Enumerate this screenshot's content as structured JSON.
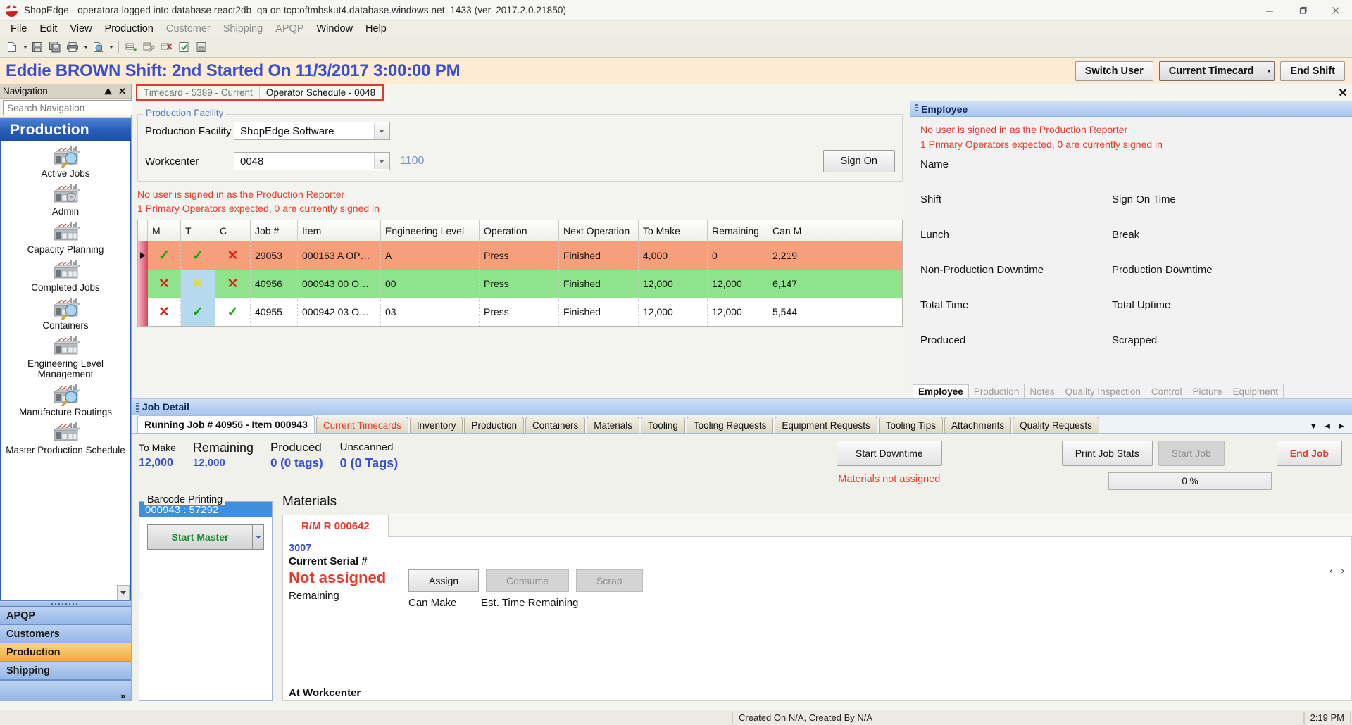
{
  "window": {
    "title": "ShopEdge - operatora logged into database react2db_qa on tcp:oftmbskut4.database.windows.net, 1433 (ver. 2017.2.0.21850)",
    "minimize": "minimize-icon",
    "maximize": "maximize-icon",
    "close": "close-icon"
  },
  "menu": [
    {
      "label": "File",
      "dim": false
    },
    {
      "label": "Edit",
      "dim": false
    },
    {
      "label": "View",
      "dim": false
    },
    {
      "label": "Production",
      "dim": false
    },
    {
      "label": "Customer",
      "dim": true
    },
    {
      "label": "Shipping",
      "dim": true
    },
    {
      "label": "APQP",
      "dim": true
    },
    {
      "label": "Window",
      "dim": false
    },
    {
      "label": "Help",
      "dim": false
    }
  ],
  "toolbar": {
    "items": [
      "new-document-icon",
      "save-icon",
      "save-all-icon",
      "print-icon",
      "print-preview-icon",
      "add-record-icon",
      "edit-record-icon",
      "delete-record-icon",
      "commit-icon",
      "export-icon"
    ]
  },
  "userbar": {
    "heading": "Eddie BROWN Shift: 2nd Started On 11/3/2017 3:00:00 PM",
    "switch_user": "Switch User",
    "current_timecard": "Current Timecard",
    "end_shift": "End Shift"
  },
  "navigation": {
    "title": "Navigation",
    "search_placeholder": "Search Navigation",
    "search_value": "",
    "clear_label": "X",
    "group_title": "Production",
    "items": [
      {
        "label": "Active Jobs",
        "icon": "factory-search-icon"
      },
      {
        "label": "Admin",
        "icon": "factory-gear-icon"
      },
      {
        "label": "Capacity Planning",
        "icon": "factory-icon"
      },
      {
        "label": "Completed Jobs",
        "icon": "factory-icon"
      },
      {
        "label": "Containers",
        "icon": "factory-search-icon"
      },
      {
        "label": "Engineering Level Management",
        "icon": "factory-icon"
      },
      {
        "label": "Manufacture Routings",
        "icon": "factory-search-icon"
      },
      {
        "label": "Master Production Schedule",
        "icon": "factory-icon"
      }
    ],
    "bars": [
      {
        "label": "APQP",
        "active": false
      },
      {
        "label": "Customers",
        "active": false
      },
      {
        "label": "Production",
        "active": true
      },
      {
        "label": "Shipping",
        "active": false
      }
    ],
    "overflow": "»"
  },
  "document_tabs": {
    "tabs": [
      {
        "label": "Timecard - 5389 - Current",
        "selected": false
      },
      {
        "label": "Operator Schedule - 0048",
        "selected": true
      }
    ],
    "close_label": "✕"
  },
  "facility": {
    "legend": "Production Facility",
    "facility_label": "Production Facility",
    "facility_value": "ShopEdge Software",
    "workcenter_label": "Workcenter",
    "workcenter_value": "0048",
    "workcenter_code": "1100",
    "sign_on": "Sign On"
  },
  "warnings": {
    "no_reporter": "No user is signed in as the Production Reporter",
    "operators": "1 Primary Operators expected, 0 are currently signed in"
  },
  "jobs_grid": {
    "columns": [
      "M",
      "T",
      "C",
      "Job #",
      "Item",
      "Engineering Level",
      "Operation",
      "Next Operation",
      "To Make",
      "Remaining",
      "Can M"
    ],
    "rows": [
      {
        "current": true,
        "row_color": "orange",
        "m": "check",
        "t": "check",
        "c": "cross",
        "m_color": "green",
        "t_color": "green",
        "c_color": "red",
        "t_cell_highlight": false,
        "job": "29053",
        "item": "000163 A OP…",
        "eng_level": "A",
        "operation": "Press",
        "next_operation": "Finished",
        "to_make": "4,000",
        "remaining": "0",
        "can_make": "2,219"
      },
      {
        "current": false,
        "row_color": "green",
        "m": "cross",
        "t": "cross",
        "c": "cross",
        "m_color": "red",
        "t_color": "yellow",
        "c_color": "red",
        "t_cell_highlight": true,
        "job": "40956",
        "item": "000943 00 O…",
        "eng_level": "00",
        "operation": "Press",
        "next_operation": "Finished",
        "to_make": "12,000",
        "remaining": "12,000",
        "can_make": "6,147"
      },
      {
        "current": false,
        "row_color": "white",
        "m": "cross",
        "t": "check",
        "c": "check",
        "m_color": "red",
        "t_color": "green",
        "c_color": "green",
        "t_cell_highlight": true,
        "job": "40955",
        "item": "000942 03 O…",
        "eng_level": "03",
        "operation": "Press",
        "next_operation": "Finished",
        "to_make": "12,000",
        "remaining": "12,000",
        "can_make": "5,544"
      }
    ]
  },
  "employee": {
    "panel_title": "Employee",
    "warn1": "No user is signed in as the Production Reporter",
    "warn2": "1 Primary Operators expected, 0 are currently signed in",
    "fields": [
      {
        "left": "Name",
        "right": ""
      },
      {
        "left": "Shift",
        "right": "Sign On Time"
      },
      {
        "left": "Lunch",
        "right": "Break"
      },
      {
        "left": "Non-Production Downtime",
        "right": "Production Downtime"
      },
      {
        "left": "Total Time",
        "right": "Total Uptime"
      },
      {
        "left": "Produced",
        "right": "Scrapped"
      }
    ],
    "tabs": [
      {
        "label": "Employee",
        "selected": true
      },
      {
        "label": "Production",
        "selected": false
      },
      {
        "label": "Notes",
        "selected": false
      },
      {
        "label": "Quality Inspection",
        "selected": false
      },
      {
        "label": "Control",
        "selected": false
      },
      {
        "label": "Picture",
        "selected": false
      },
      {
        "label": "Equipment",
        "selected": false
      }
    ]
  },
  "job_detail": {
    "panel_title": "Job Detail",
    "tabs": [
      {
        "label": "Running Job # 40956 - Item 000943",
        "selected": true,
        "red": false
      },
      {
        "label": "Current Timecards",
        "selected": false,
        "red": true
      },
      {
        "label": "Inventory",
        "selected": false,
        "red": false
      },
      {
        "label": "Production",
        "selected": false,
        "red": false
      },
      {
        "label": "Containers",
        "selected": false,
        "red": false
      },
      {
        "label": "Materials",
        "selected": false,
        "red": false
      },
      {
        "label": "Tooling",
        "selected": false,
        "red": false
      },
      {
        "label": "Tooling Requests",
        "selected": false,
        "red": false
      },
      {
        "label": "Equipment Requests",
        "selected": false,
        "red": false
      },
      {
        "label": "Tooling Tips",
        "selected": false,
        "red": false
      },
      {
        "label": "Attachments",
        "selected": false,
        "red": false
      },
      {
        "label": "Quality Requests",
        "selected": false,
        "red": false
      }
    ],
    "tab_nav": {
      "dropdown": "▼",
      "prev": "◄",
      "next": "►"
    },
    "stats": [
      {
        "label": "To Make",
        "value": "12,000",
        "label_size": 14,
        "value_size": 16
      },
      {
        "label": "Remaining",
        "value": "12,000",
        "label_size": 18,
        "value_size": 15
      },
      {
        "label": "Produced",
        "value": "0 (0 tags)",
        "label_size": 17,
        "value_size": 17
      },
      {
        "label": "Unscanned",
        "value": "0 (0 Tags)",
        "label_size": 15,
        "value_size": 18
      }
    ],
    "start_downtime": "Start Downtime",
    "materials_msg": "Materials not assigned",
    "print_job_stats": "Print Job Stats",
    "start_job": "Start Job",
    "end_job": "End Job",
    "progress": "0 %"
  },
  "barcode": {
    "legend": "Barcode Printing",
    "selected_item": "000943 : 57292",
    "start_master": "Start Master"
  },
  "materials": {
    "title": "Materials",
    "tab_label": "R/M R 000642",
    "item_id": "3007",
    "serial_label": "Current Serial #",
    "serial_value": "Not assigned",
    "remaining_label": "Remaining",
    "assign": "Assign",
    "consume": "Consume",
    "scrap": "Scrap",
    "can_make_label": "Can Make",
    "est_time_label": "Est. Time Remaining",
    "at_workcenter": "At Workcenter",
    "prev_arrow": "‹",
    "next_arrow": "›"
  },
  "statusbar": {
    "created": "Created On N/A, Created By N/A",
    "time": "2:19 PM"
  },
  "colors": {
    "accent_blue": "#3a4fd0",
    "warning_red": "#e8392c",
    "row_orange": "#f5a07a",
    "row_green": "#8fe38a",
    "nav_active": "#f0ad3a"
  }
}
